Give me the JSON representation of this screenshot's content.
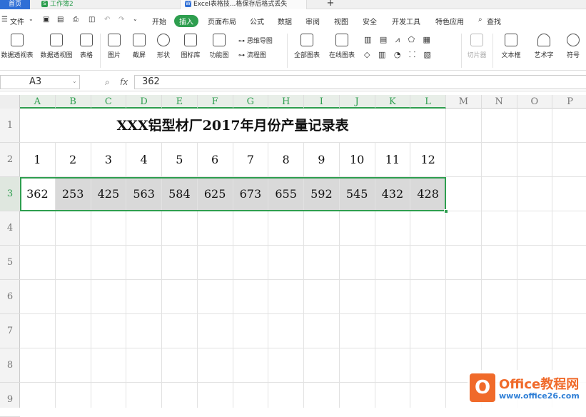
{
  "tabs": {
    "home": "首页",
    "workbook": "工作簿2",
    "workbook_badge": "S",
    "document": "Excel表格技...格保存后格式丢失",
    "document_badge": "W",
    "add": "+"
  },
  "menubar": {
    "file": "文件",
    "items": [
      "开始",
      "插入",
      "页面布局",
      "公式",
      "数据",
      "审阅",
      "视图",
      "安全",
      "开发工具",
      "特色应用"
    ],
    "search": "查找",
    "active": "插入"
  },
  "ribbon": {
    "pivot_table": "数据透视表",
    "pivot_chart": "数据透视图",
    "table": "表格",
    "picture": "图片",
    "screenshot": "截屏",
    "shape": "形状",
    "icon_library": "图标库",
    "function_chart": "功能图",
    "mind_map": "思维导图",
    "flow_chart": "流程图",
    "all_charts": "全部图表",
    "online_chart": "在线图表",
    "slicer": "切片器",
    "text_box": "文本框",
    "art_text": "艺术字",
    "symbol": "符号"
  },
  "formula_bar": {
    "name_box": "A3",
    "fx": "fx",
    "formula": "362"
  },
  "columns": [
    "A",
    "B",
    "C",
    "D",
    "E",
    "F",
    "G",
    "H",
    "I",
    "J",
    "K",
    "L",
    "M",
    "N",
    "O",
    "P"
  ],
  "selected_columns": [
    "A",
    "B",
    "C",
    "D",
    "E",
    "F",
    "G",
    "H",
    "I",
    "J",
    "K",
    "L"
  ],
  "rows": [
    "1",
    "2",
    "3",
    "4",
    "5",
    "6",
    "7",
    "8",
    "9"
  ],
  "selected_row": "3",
  "sheet": {
    "title": "XXX铝型材厂2017年月份产量记录表",
    "months": [
      "1",
      "2",
      "3",
      "4",
      "5",
      "6",
      "7",
      "8",
      "9",
      "10",
      "11",
      "12"
    ],
    "values": [
      "362",
      "253",
      "425",
      "563",
      "584",
      "625",
      "673",
      "655",
      "592",
      "545",
      "432",
      "428"
    ]
  },
  "watermark": {
    "mark": "O",
    "name": "Office教程网",
    "url": "www.office26.com"
  },
  "colors": {
    "accent": "#2e9e4f",
    "home_tab": "#2f6fd6",
    "watermark_orange": "#f06a2a",
    "watermark_blue": "#2f7fd6"
  }
}
